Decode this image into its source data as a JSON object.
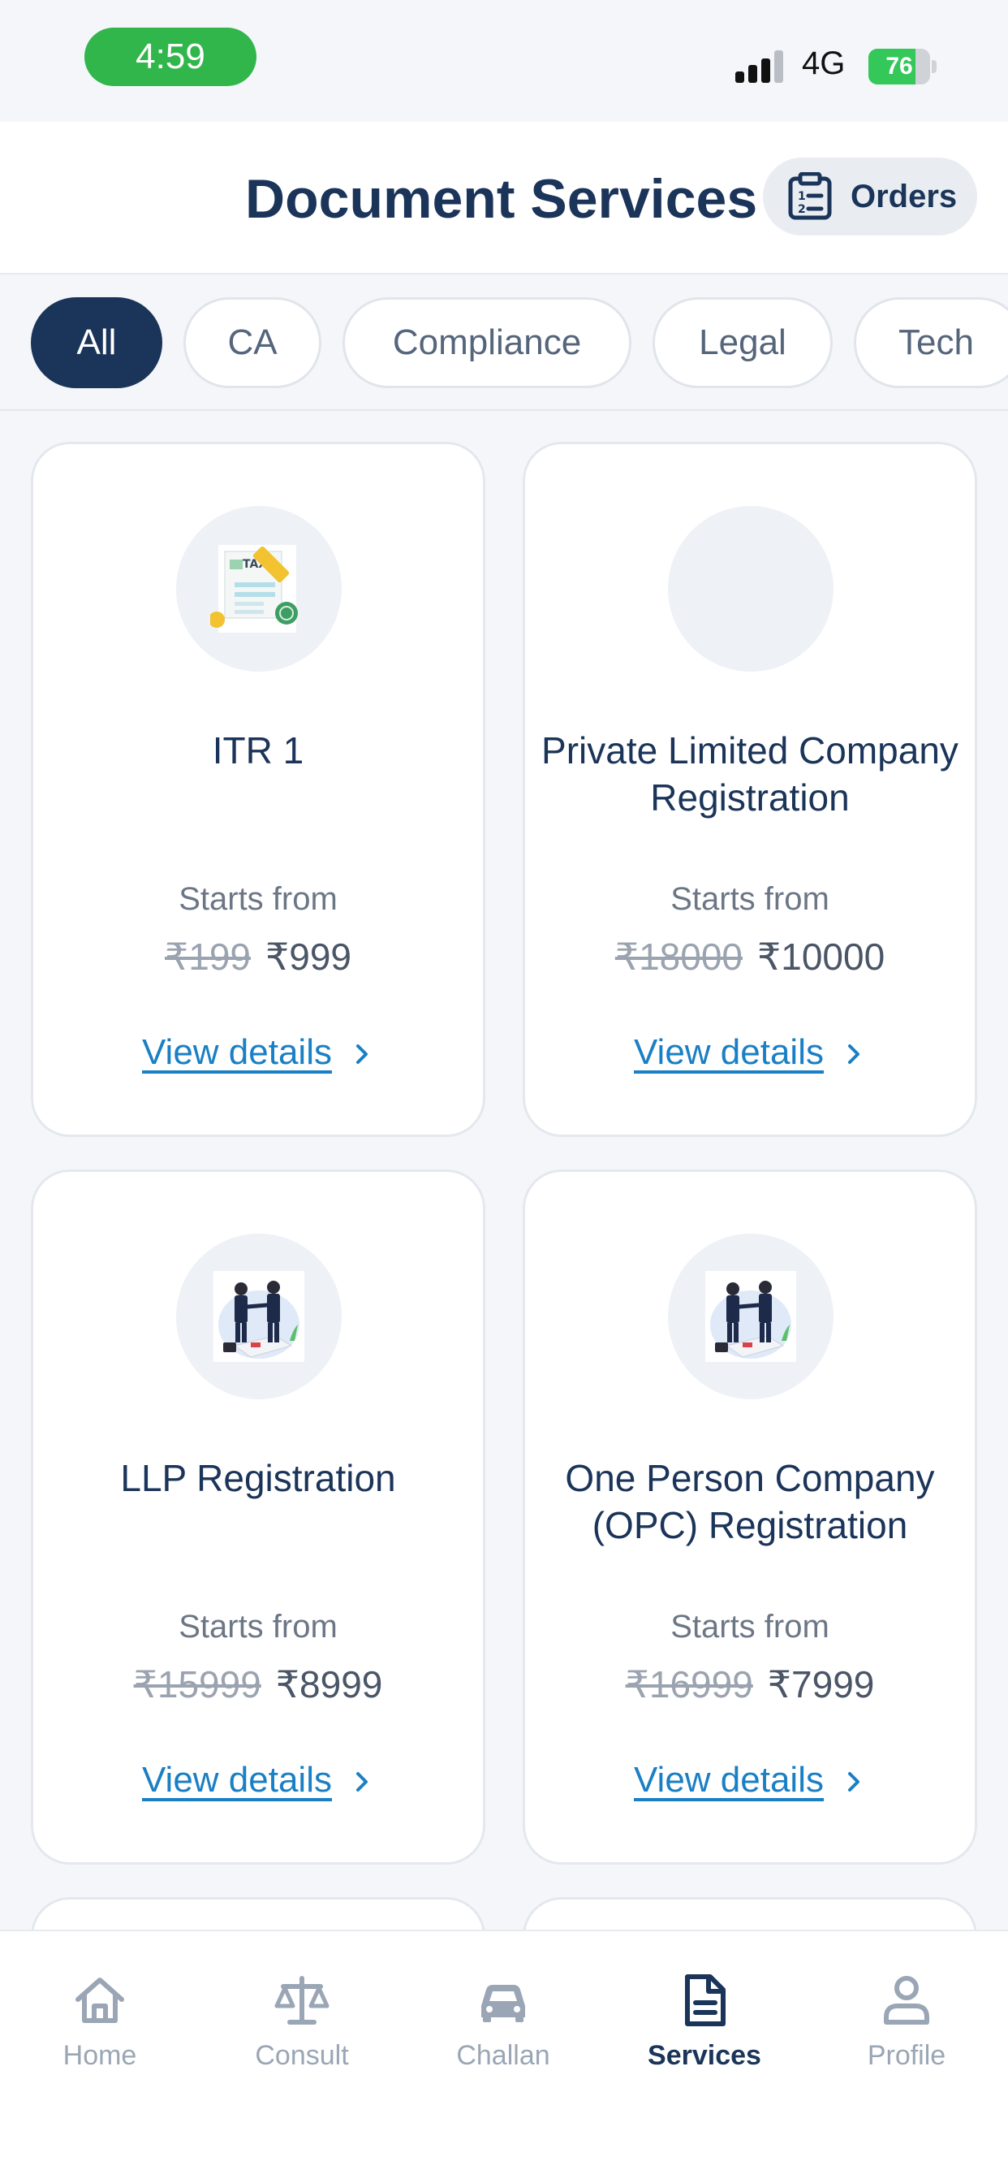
{
  "status_bar": {
    "time": "4:59",
    "network": "4G",
    "battery": "76",
    "battery_level": 0.76
  },
  "header": {
    "title": "Document Services",
    "orders_label": "Orders"
  },
  "filters": [
    {
      "label": "All",
      "active": true
    },
    {
      "label": "CA"
    },
    {
      "label": "Compliance"
    },
    {
      "label": "Legal"
    },
    {
      "label": "Tech"
    }
  ],
  "services": [
    {
      "title": "ITR 1",
      "starts_label": "Starts from",
      "old_price": "₹199",
      "price": "₹999",
      "details_label": "View details",
      "icon": "tax-document-icon"
    },
    {
      "title": "Private Limited Company Registration",
      "starts_label": "Starts from",
      "old_price": "₹18000",
      "price": "₹10000",
      "details_label": "View details",
      "icon": "blank-icon"
    },
    {
      "title": "LLP Registration",
      "starts_label": "Starts from",
      "old_price": "₹15999",
      "price": "₹8999",
      "details_label": "View details",
      "icon": "handshake-icon"
    },
    {
      "title": "One Person Company (OPC) Registration",
      "starts_label": "Starts from",
      "old_price": "₹16999",
      "price": "₹7999",
      "details_label": "View details",
      "icon": "handshake-icon"
    }
  ],
  "nav": [
    {
      "label": "Home",
      "icon": "home-icon"
    },
    {
      "label": "Consult",
      "icon": "scale-icon"
    },
    {
      "label": "Challan",
      "icon": "car-icon"
    },
    {
      "label": "Services",
      "icon": "document-icon",
      "active": true
    },
    {
      "label": "Profile",
      "icon": "person-icon"
    }
  ],
  "colors": {
    "primary": "#1b3459",
    "link": "#1a7fc4",
    "status_green": "#30b64a",
    "inactive": "#9aa6b5"
  }
}
